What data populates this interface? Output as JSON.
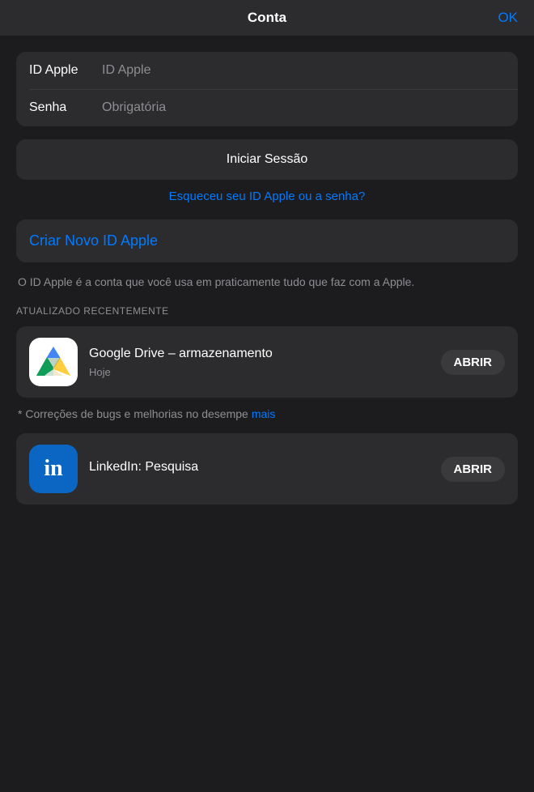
{
  "topBar": {
    "title": "Conta",
    "okLabel": "OK"
  },
  "loginForm": {
    "appleIdLabel": "ID Apple",
    "appleIdPlaceholder": "ID Apple",
    "passwordLabel": "Senha",
    "passwordPlaceholder": "Obrigatória"
  },
  "signInButton": {
    "label": "Iniciar Sessão"
  },
  "forgotLink": {
    "label": "Esqueceu seu ID Apple ou a senha?"
  },
  "createIdButton": {
    "label": "Criar Novo ID Apple"
  },
  "descriptionText": "O ID Apple é a conta que você usa em praticamente tudo que faz com a Apple.",
  "sectionHeader": "ATUALIZADO RECENTEMENTE",
  "googleDriveApp": {
    "name": "Google Drive – armazenamento",
    "date": "Hoje",
    "openLabel": "ABRIR"
  },
  "updateNotes": {
    "text": "* Correções de bugs e melhorias no desempe",
    "moreLabel": "mais"
  },
  "linkedInApp": {
    "name": "LinkedIn: Pesquisa",
    "openLabel": "ABRIR"
  }
}
